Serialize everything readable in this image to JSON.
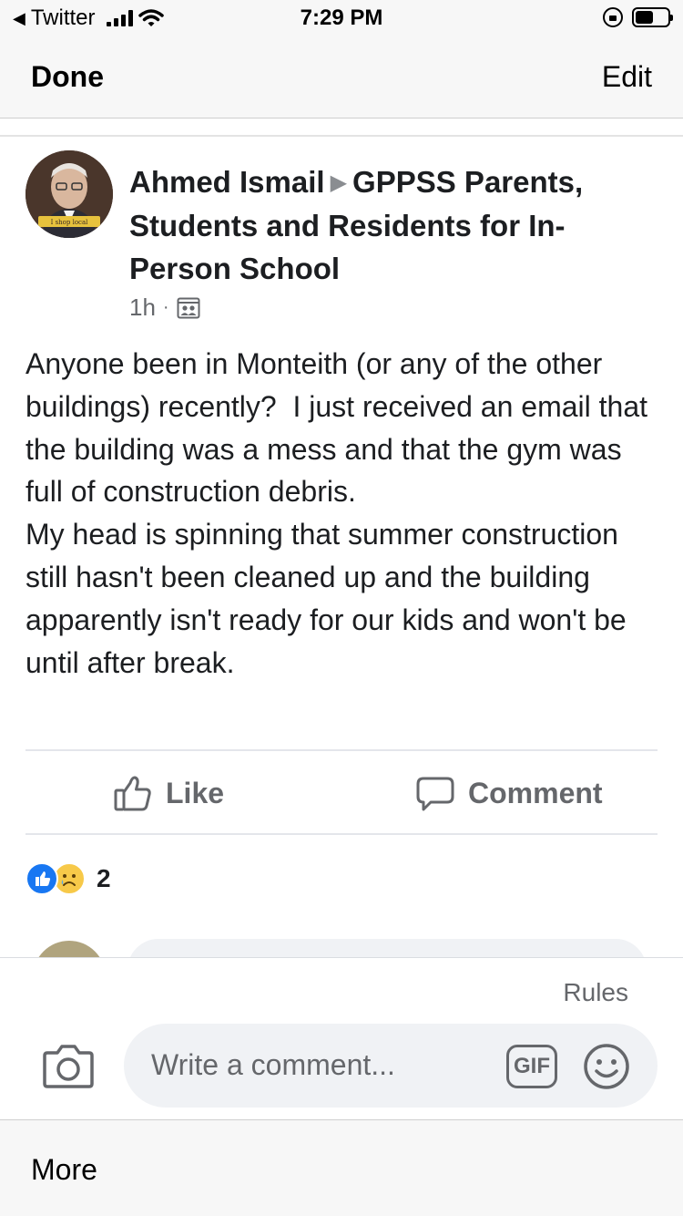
{
  "status_bar": {
    "back_app": "Twitter",
    "time": "7:29 PM",
    "signal_bars": 4,
    "battery_level": 0.55
  },
  "nav": {
    "done_label": "Done",
    "edit_label": "Edit"
  },
  "post": {
    "author": "Ahmed Ismail",
    "group": "GPPSS Parents, Students and Residents for In-Person School",
    "time_ago": "1h",
    "visibility_icon": "group-icon",
    "text": "Anyone been in Monteith (or any of the other buildings) recently?  I just received an email that the building was a mess and that the gym was full of construction debris.\nMy head is spinning that summer construction still hasn't been cleaned up and the building apparently isn't ready for our kids and won't be until after break.",
    "avatar_badge_text": "I shop local"
  },
  "actions": {
    "like_label": "Like",
    "comment_label": "Comment"
  },
  "reactions": {
    "types": [
      "like",
      "sad"
    ],
    "count": "2"
  },
  "composer": {
    "rules_label": "Rules",
    "placeholder": "Write a comment...",
    "gif_label": "GIF"
  },
  "bottom_bar": {
    "more_label": "More"
  },
  "colors": {
    "facebook_blue": "#1877f2",
    "secondary_text": "#65676b",
    "sad_yellow": "#f7c949"
  }
}
